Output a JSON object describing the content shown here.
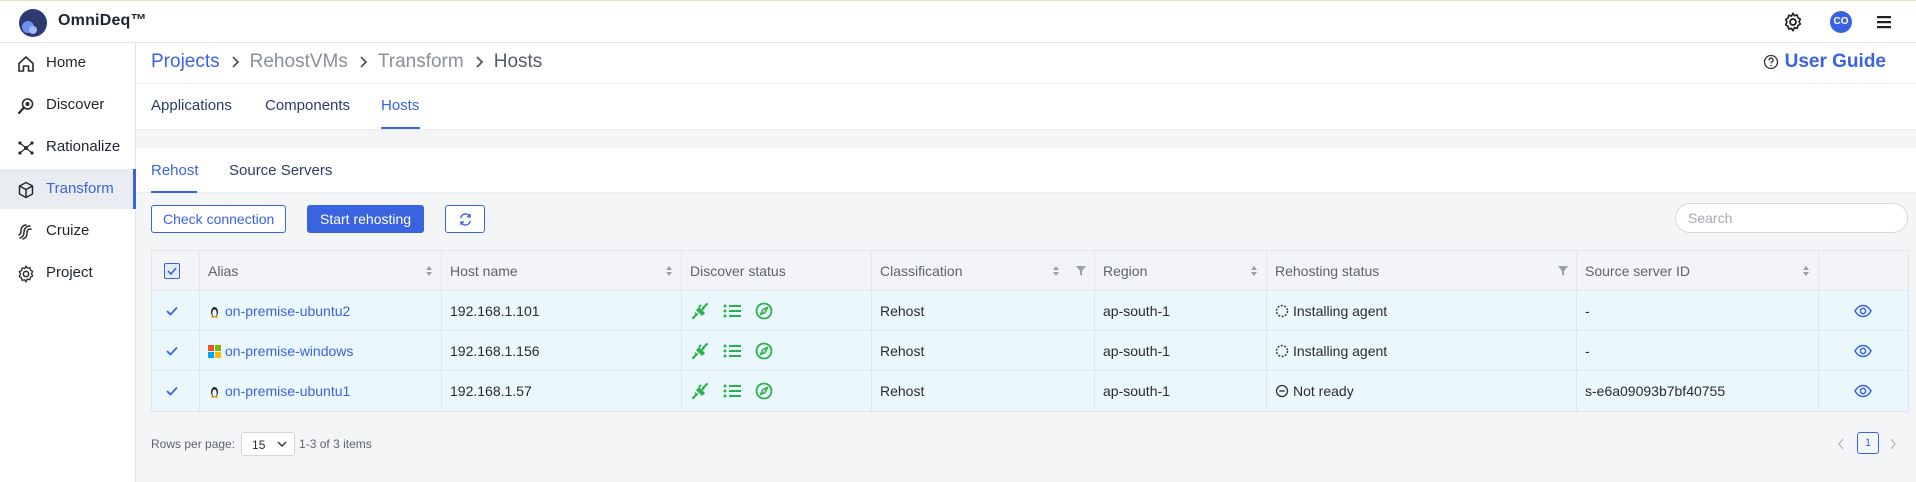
{
  "app": {
    "brand": "OmniDeq™",
    "avatar_initials": "CO"
  },
  "topbar": {
    "icons": [
      "gear-icon",
      "avatar",
      "hamburger-menu-icon"
    ]
  },
  "sidebar": {
    "items": [
      {
        "label": "Home",
        "icon": "home-icon",
        "active": false
      },
      {
        "label": "Discover",
        "icon": "discover-search-icon",
        "active": false
      },
      {
        "label": "Rationalize",
        "icon": "rationalize-icon",
        "active": false
      },
      {
        "label": "Transform",
        "icon": "cube-icon",
        "active": true
      },
      {
        "label": "Cruize",
        "icon": "cruize-icon",
        "active": false
      },
      {
        "label": "Project",
        "icon": "gear-icon",
        "active": false
      }
    ]
  },
  "breadcrumb": {
    "items": [
      "Projects",
      "RehostVMs",
      "Transform",
      "Hosts"
    ]
  },
  "user_guide": {
    "label": "User Guide"
  },
  "tabs": [
    "Applications",
    "Components",
    "Hosts"
  ],
  "active_tab": "Hosts",
  "subtabs": [
    "Rehost",
    "Source Servers"
  ],
  "active_subtab": "Rehost",
  "toolbar": {
    "check_connection": "Check connection",
    "start_rehosting": "Start rehosting",
    "search_placeholder": "Search"
  },
  "table": {
    "columns": [
      "Alias",
      "Host name",
      "Discover status",
      "Classification",
      "Region",
      "Rehosting status",
      "Source server ID"
    ],
    "rows": [
      {
        "alias": "on-premise-ubuntu2",
        "os": "linux-tux-icon",
        "host_name": "192.168.1.101",
        "classification": "Rehost",
        "region": "ap-south-1",
        "rehosting_status": "Installing agent",
        "status_icon": "spinner-icon",
        "source_server_id": "-"
      },
      {
        "alias": "on-premise-windows",
        "os": "windows-logo-icon",
        "host_name": "192.168.1.156",
        "classification": "Rehost",
        "region": "ap-south-1",
        "rehosting_status": "Installing agent",
        "status_icon": "spinner-icon",
        "source_server_id": "-"
      },
      {
        "alias": "on-premise-ubuntu1",
        "os": "linux-tux-icon",
        "host_name": "192.168.1.57",
        "classification": "Rehost",
        "region": "ap-south-1",
        "rehosting_status": "Not ready",
        "status_icon": "not-ready-icon",
        "source_server_id": "s-e6a09093b7bf40755"
      }
    ]
  },
  "pagination": {
    "rows_per_page_label": "Rows per page:",
    "rows_per_page": "15",
    "range": "1-3 of 3 items",
    "current_page": "1"
  },
  "colors": {
    "accent": "#3a63e0",
    "success": "#2bb24c",
    "row_highlight": "#eaf7fd"
  }
}
